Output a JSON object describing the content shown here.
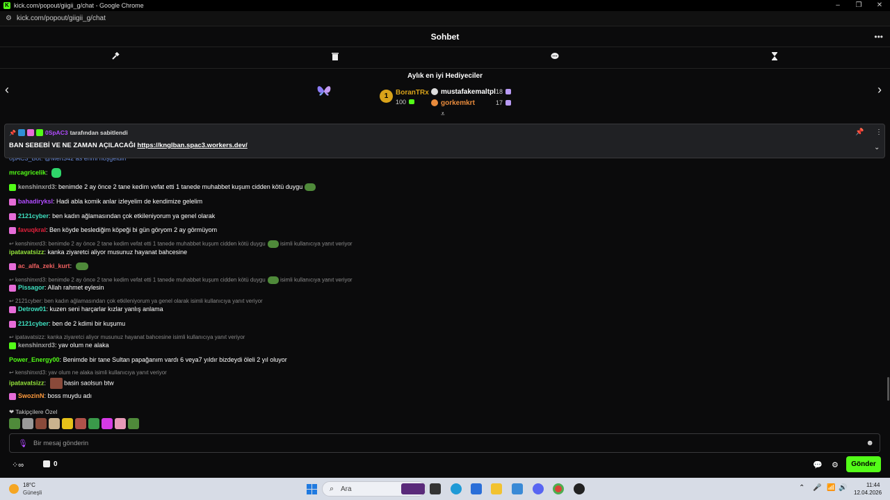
{
  "window": {
    "title": "kick.com/popout/giigii_g/chat - Google Chrome",
    "url": "kick.com/popout/giigii_g/chat"
  },
  "header": {
    "title": "Sohbet"
  },
  "gifters": {
    "title": "Aylık en iyi Hediyeciler",
    "rank_badge": "1",
    "first": {
      "name": "BoranTRx",
      "value": "100"
    },
    "second": {
      "name": "mustafakemaltpl",
      "value": "18"
    },
    "third": {
      "name": "gorkemkrt",
      "value": "17"
    }
  },
  "pinned": {
    "user": "0SpAC3",
    "pinned_by": "tarafından sabitlendi",
    "text": "BAN SEBEBİ VE NE ZAMAN AÇILACAĞI",
    "link": "https://knglban.spac3.workers.dev/",
    "partial": "0pAC3_Bot: @Mert342 as ehmi hoşgeldin"
  },
  "messages": [
    {
      "user": "mrcagricelik",
      "text": "",
      "color": "#53fc18"
    },
    {
      "user": "kenshinxrd3",
      "text": "benimde 2 ay önce 2 tane kedim vefat etti 1 tanede muhabbet kuşum cidden kötü duygu",
      "color": "#a3a3a3"
    },
    {
      "user": "bahadiryksl",
      "text": "Hadi abla komik anlar izleyelim de kendimize gelelim",
      "color": "#b14bff"
    },
    {
      "user": "2121cyber",
      "text": "ben kadın ağlamasından çok etkileniyorum ya genel olarak",
      "color": "#3ee0c0"
    },
    {
      "user": "favuqkral",
      "text": "Ben köyde beslediğim köpeği bi gün göryom 2 ay görmüyom",
      "color": "#e0203b"
    },
    {
      "reply": "kenshinxrd3: benimde 2 ay önce 2 tane kedim vefat etti 1 tanede muhabbet kuşum cidden kötü duygu",
      "reply_suffix": "isimli kullanıcıya yanıt veriyor"
    },
    {
      "user": "ipatavatsizz",
      "text": "kanka ziyaretci aliyor musunuz hayanat bahcesine",
      "color": "#93e23a"
    },
    {
      "user": "ac_alfa_zeki_kurt",
      "text": "",
      "color": "#f06060"
    },
    {
      "reply": "kenshinxrd3: benimde 2 ay önce 2 tane kedim vefat etti 1 tanede muhabbet kuşum cidden kötü duygu",
      "reply_suffix": "isimli kullanıcıya yanıt veriyor"
    },
    {
      "user": "Pissagor",
      "text": "Allah rahmet eylesin",
      "color": "#3ee0c0"
    },
    {
      "reply": "2121cyber: ben kadın ağlamasından çok etkileniyorum ya genel olarak isimli kullanıcıya yanıt veriyor",
      "reply_suffix": ""
    },
    {
      "user": "Detrow01",
      "text": "kuzen seni harçarlar kızlar yanlış anlama",
      "color": "#3ee0c0"
    },
    {
      "user": "2121cyber",
      "text": "ben de 2 kdimi bir kuşumu",
      "color": "#3ee0c0"
    },
    {
      "reply": "ipatavatsizz: kanka ziyaretci aliyor musunuz hayanat bahcesine isimli kullanıcıya yanıt veriyor",
      "reply_suffix": ""
    },
    {
      "user": "kenshinxrd3",
      "text": "yav olum ne alaka",
      "color": "#a3a3a3"
    },
    {
      "user": "Power_Energy00",
      "text": "Benimde bir tane Sultan papağanım vardı 6 veya7 yıldır bizdeydi öleli 2 yıl oluyor",
      "color": "#53fc18"
    },
    {
      "reply": "kenshinxrd3: yav olum ne alaka isimli kullanıcıya yanıt veriyor",
      "reply_suffix": ""
    },
    {
      "user": "ipatavatsizz",
      "text": "basin saolsun btw",
      "color": "#93e23a"
    },
    {
      "user": "SwozinN",
      "text": "boss muydu adı",
      "color": "#ff9a3c"
    }
  ],
  "followers_label": "Takipçilere Özel",
  "input": {
    "placeholder": "Bir mesaj gönderin"
  },
  "bottom": {
    "count": "0",
    "send_label": "Gönder"
  },
  "taskbar": {
    "weather_temp": "18°C",
    "weather_desc": "Güneşli",
    "search": "Ara",
    "time": "11:44",
    "date": "12.04.2026"
  },
  "colors": {
    "accent": "#53fc18",
    "background": "#0b0b0c"
  }
}
